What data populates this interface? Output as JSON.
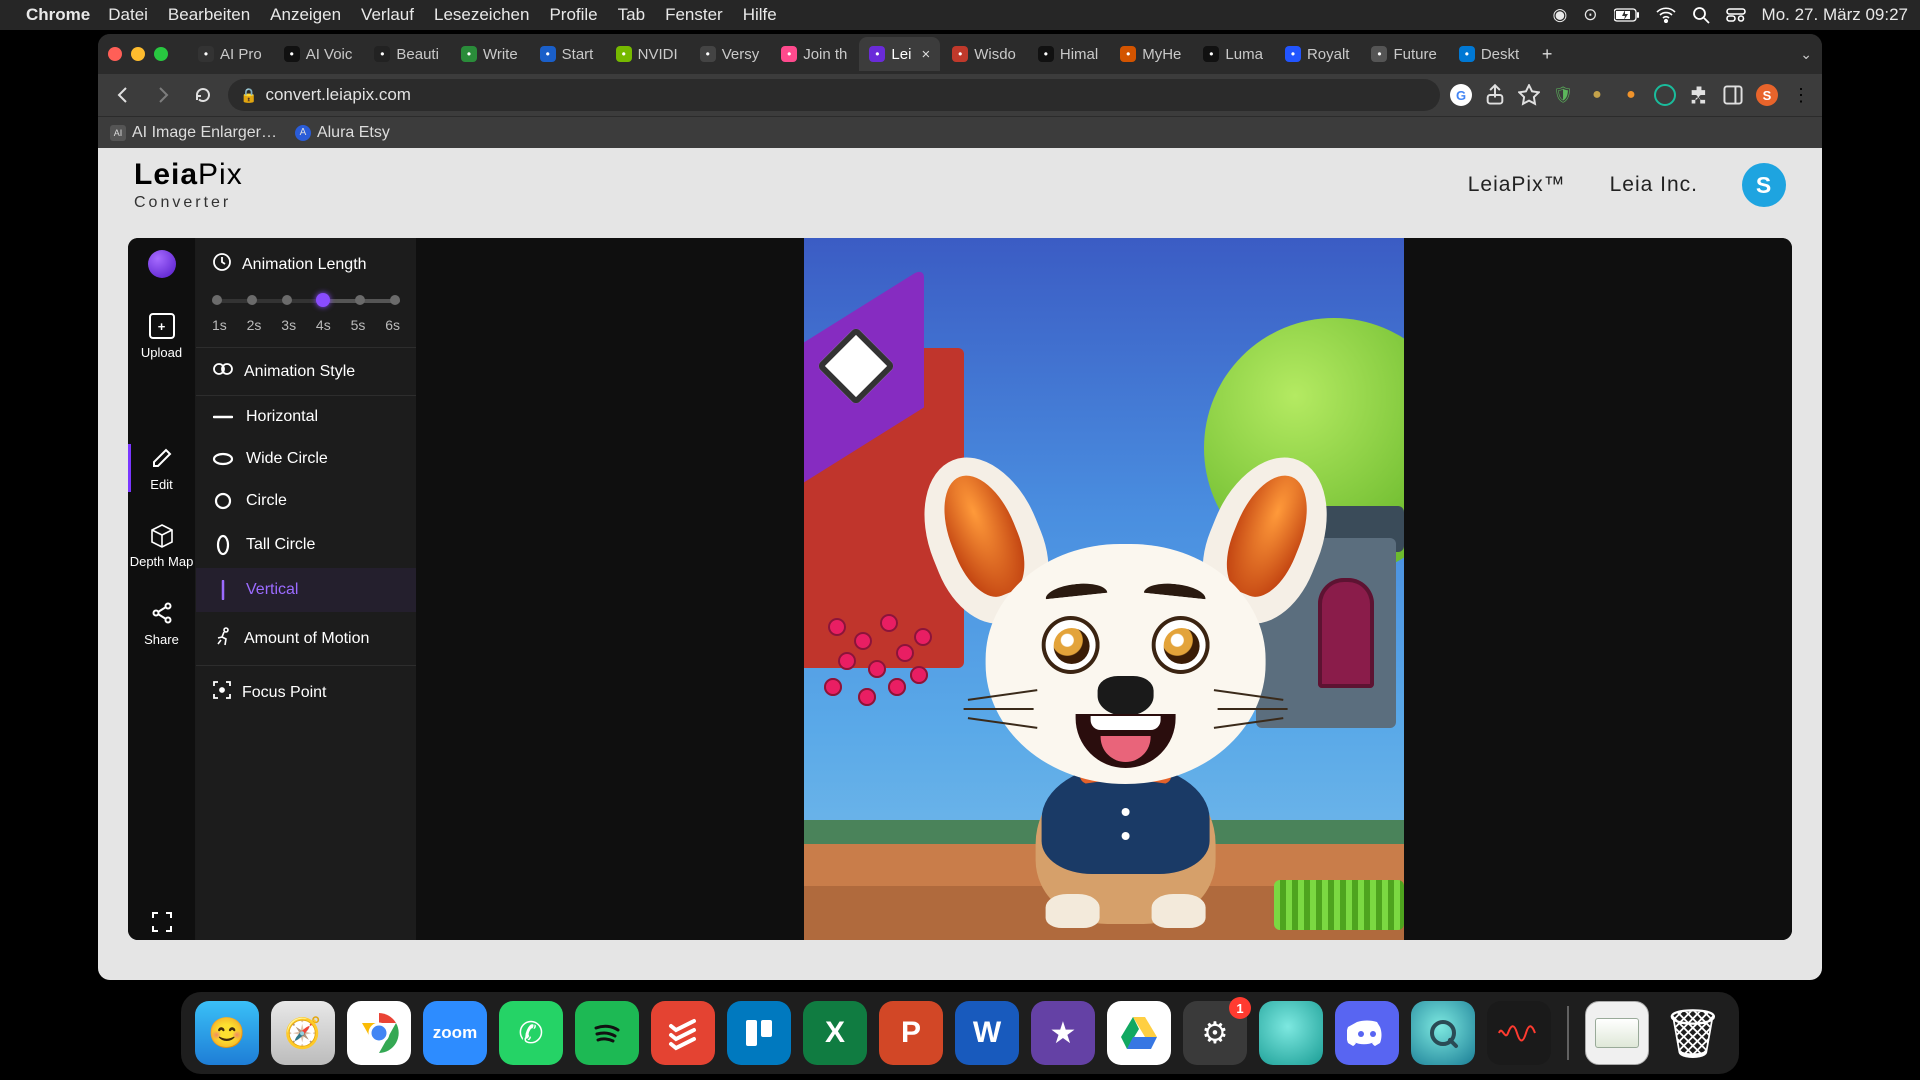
{
  "menubar": {
    "app": "Chrome",
    "items": [
      "Datei",
      "Bearbeiten",
      "Anzeigen",
      "Verlauf",
      "Lesezeichen",
      "Profile",
      "Tab",
      "Fenster",
      "Hilfe"
    ],
    "clock": "Mo. 27. März  09:27"
  },
  "tabs": [
    {
      "label": "AI Pro",
      "favbg": "#333"
    },
    {
      "label": "AI Voic",
      "favbg": "#111"
    },
    {
      "label": "Beauti",
      "favbg": "#222"
    },
    {
      "label": "Write",
      "favbg": "#2a8c3a"
    },
    {
      "label": "Start",
      "favbg": "#1a5fc9"
    },
    {
      "label": "NVIDI",
      "favbg": "#76b900"
    },
    {
      "label": "Versy",
      "favbg": "#444"
    },
    {
      "label": "Join th",
      "favbg": "#ff4a8d"
    },
    {
      "label": "Lei",
      "favbg": "#6a2bd9",
      "active": true
    },
    {
      "label": "Wisdo",
      "favbg": "#c0392b"
    },
    {
      "label": "Himal",
      "favbg": "#111"
    },
    {
      "label": "MyHe",
      "favbg": "#d35400"
    },
    {
      "label": "Luma",
      "favbg": "#111"
    },
    {
      "label": "Royalt",
      "favbg": "#2255ff"
    },
    {
      "label": "Future",
      "favbg": "#555"
    },
    {
      "label": "Deskt",
      "favbg": "#0078d4"
    }
  ],
  "url": "convert.leiapix.com",
  "bookmarks": [
    {
      "label": "AI Image Enlarger…"
    },
    {
      "label": "Alura Etsy"
    }
  ],
  "logo": {
    "main_bold": "Leia",
    "main_light": "Pix",
    "sub": "Converter"
  },
  "nav": {
    "link1": "LeiaPix™",
    "link2": "Leia Inc.",
    "user_initial": "S"
  },
  "rail": {
    "upload": "Upload",
    "edit": "Edit",
    "depth": "Depth Map",
    "share": "Share"
  },
  "panel": {
    "anim_length": "Animation Length",
    "length_ticks": [
      "1s",
      "2s",
      "3s",
      "4s",
      "5s",
      "6s"
    ],
    "length_selected_index": 3,
    "anim_style": "Animation Style",
    "styles": [
      {
        "name": "Horizontal"
      },
      {
        "name": "Wide Circle"
      },
      {
        "name": "Circle"
      },
      {
        "name": "Tall Circle"
      },
      {
        "name": "Vertical",
        "selected": true
      }
    ],
    "motion": "Amount of Motion",
    "focus": "Focus Point"
  },
  "toolbar_avatar": "S",
  "dock_badge": "1"
}
